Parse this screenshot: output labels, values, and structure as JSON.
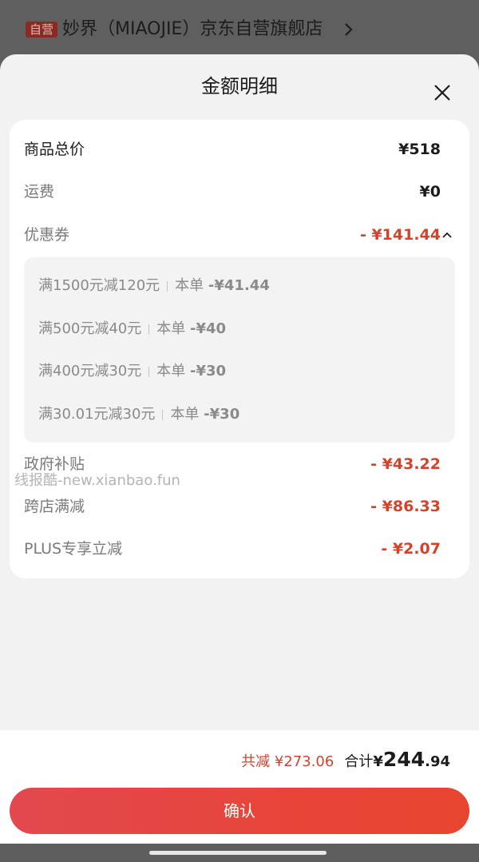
{
  "store": {
    "tag": "自营",
    "name": "妙界（MIAOJIE）京东自营旗舰店"
  },
  "sheet": {
    "title": "金额明细"
  },
  "rows": {
    "goods_total": {
      "label": "商品总价",
      "value": "¥518"
    },
    "shipping": {
      "label": "运费",
      "value": "¥0"
    },
    "coupon": {
      "label": "优惠券",
      "value": "- ¥141.44"
    },
    "gov_subsidy": {
      "label": "政府补贴",
      "value": "- ¥43.22"
    },
    "cross_store": {
      "label": "跨店满减",
      "value": "- ¥86.33"
    },
    "plus": {
      "label": "PLUS专享立减",
      "value": "- ¥2.07"
    }
  },
  "coupons": [
    {
      "rule": "满1500元减120元",
      "scope": "本单",
      "amount": "-¥41.44"
    },
    {
      "rule": "满500元减40元",
      "scope": "本单",
      "amount": "-¥40"
    },
    {
      "rule": "满400元减30元",
      "scope": "本单",
      "amount": "-¥30"
    },
    {
      "rule": "满30.01元减30元",
      "scope": "本单",
      "amount": "-¥30"
    }
  ],
  "watermark": "线报酷-new.xianbao.fun",
  "footer": {
    "total_reduce": "共减 ¥273.06",
    "total_label": "合计",
    "total_yen": "¥",
    "total_int": "244",
    "total_dec": ".94",
    "confirm_label": "确认"
  },
  "colors": {
    "accent_red": "#d2432c",
    "button_red": "#e7452f"
  },
  "icons": {
    "close": "close-icon",
    "chevron_right": "chevron-right-icon",
    "caret_up": "chevron-up-icon"
  }
}
